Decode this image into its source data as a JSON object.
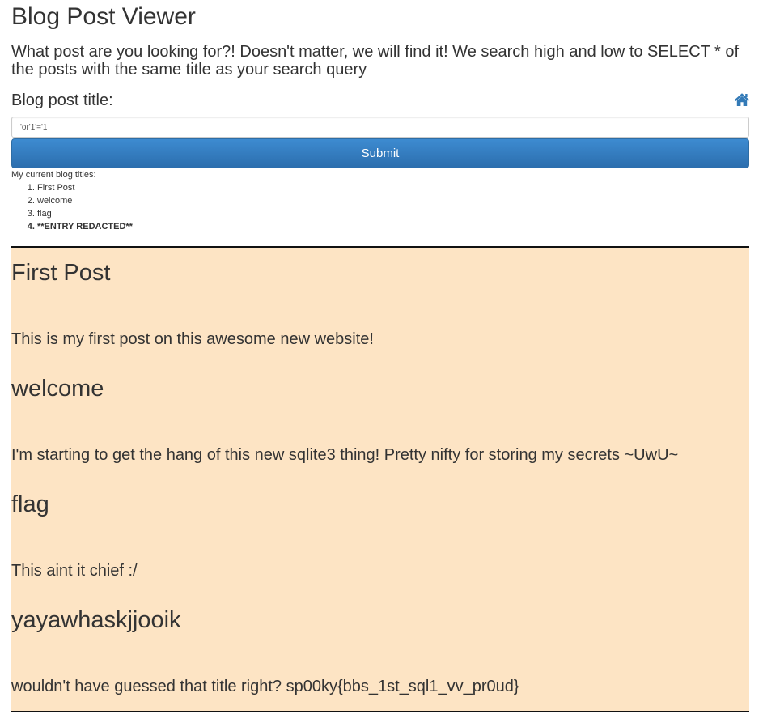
{
  "header": {
    "title": "Blog Post Viewer",
    "intro": "What post are you looking for?! Doesn't matter, we will find it! We search high and low to SELECT * of the posts with the same title as your search query"
  },
  "search": {
    "label": "Blog post title:",
    "value": "'or'1'='1",
    "submit_label": "Submit",
    "home_icon": "home-icon"
  },
  "titles": {
    "heading": "My current blog titles:",
    "items": [
      "First Post",
      "welcome",
      "flag",
      "**ENTRY REDACTED**"
    ]
  },
  "posts": [
    {
      "title": "First Post",
      "body": "This is my first post on this awesome new website!"
    },
    {
      "title": "welcome",
      "body": "I'm starting to get the hang of this new sqlite3 thing! Pretty nifty for storing my secrets ~UwU~"
    },
    {
      "title": "flag",
      "body": "This aint it chief :/"
    },
    {
      "title": "yayawhaskjjooik",
      "body": "wouldn't have guessed that title right? sp00ky{bbs_1st_sql1_vv_pr0ud}"
    }
  ],
  "colors": {
    "results_background": "#fde4c4",
    "button": "#337ab7",
    "icon": "#337ab7"
  }
}
